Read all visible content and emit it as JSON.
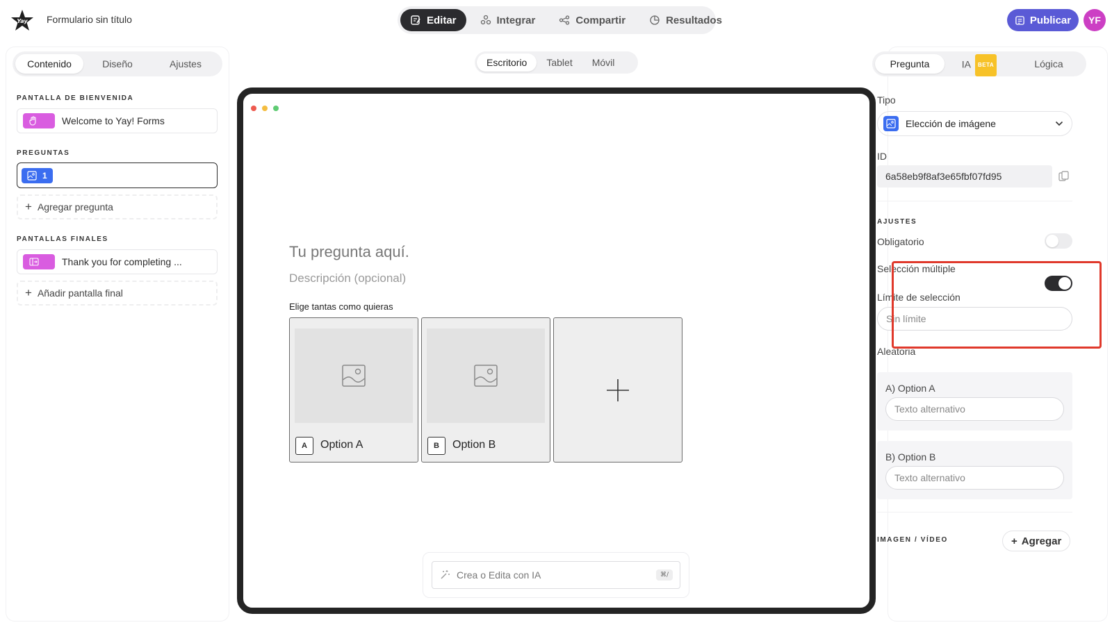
{
  "app": {
    "title": "Formulario sin título"
  },
  "topnav": {
    "items": [
      {
        "label": "Editar",
        "icon": "edit-icon",
        "active": true
      },
      {
        "label": "Integrar",
        "icon": "integrate-icon"
      },
      {
        "label": "Compartir",
        "icon": "share-icon"
      },
      {
        "label": "Resultados",
        "icon": "results-icon"
      }
    ],
    "publish_label": "Publicar",
    "avatar_initials": "YF"
  },
  "left": {
    "tabs": [
      "Contenido",
      "Diseño",
      "Ajustes"
    ],
    "welcome_heading": "PANTALLA DE BIENVENIDA",
    "welcome_item": "Welcome to Yay! Forms",
    "questions_heading": "PREGUNTAS",
    "question_number": "1",
    "add_question": "Agregar pregunta",
    "endings_heading": "PANTALLAS FINALES",
    "ending_item": "Thank you for completing ...",
    "add_ending": "Añadir pantalla final"
  },
  "center": {
    "device_tabs": [
      "Escritorio",
      "Tablet",
      "Móvil"
    ],
    "question_title": "Tu pregunta aquí.",
    "question_desc": "Descripción (opcional)",
    "hint": "Elige tantas como quieras",
    "options": [
      {
        "key": "A",
        "label": "Option A"
      },
      {
        "key": "B",
        "label": "Option B"
      }
    ],
    "ai_placeholder": "Crea o Edita con IA",
    "ai_shortcut": "⌘/"
  },
  "right": {
    "tabs": [
      "Pregunta",
      "IA",
      "Lógica"
    ],
    "beta_badge": "BETA",
    "type_label": "Tipo",
    "type_value": "Elección de imágene",
    "id_label": "ID",
    "id_value": "6a58eb9f8af3e65fbf07fd95",
    "settings_heading": "AJUSTES",
    "required_label": "Obligatorio",
    "multi_label": "Selección múltiple",
    "limit_label": "Límite de selección",
    "limit_placeholder": "Sin límite",
    "random_label": "Aleatoria",
    "alt_cards": [
      {
        "label": "A) Option A",
        "placeholder": "Texto alternativo"
      },
      {
        "label": "B) Option B",
        "placeholder": "Texto alternativo"
      }
    ],
    "media_heading": "IMAGEN / VÍDEO",
    "add_media": "Agregar"
  },
  "colors": {
    "accent": "#5a5ad6",
    "avatar": "#cc3fc4",
    "highlight": "#e0392b",
    "question_badge": "#3b6df0",
    "screen_badge": "#d95ce0"
  }
}
